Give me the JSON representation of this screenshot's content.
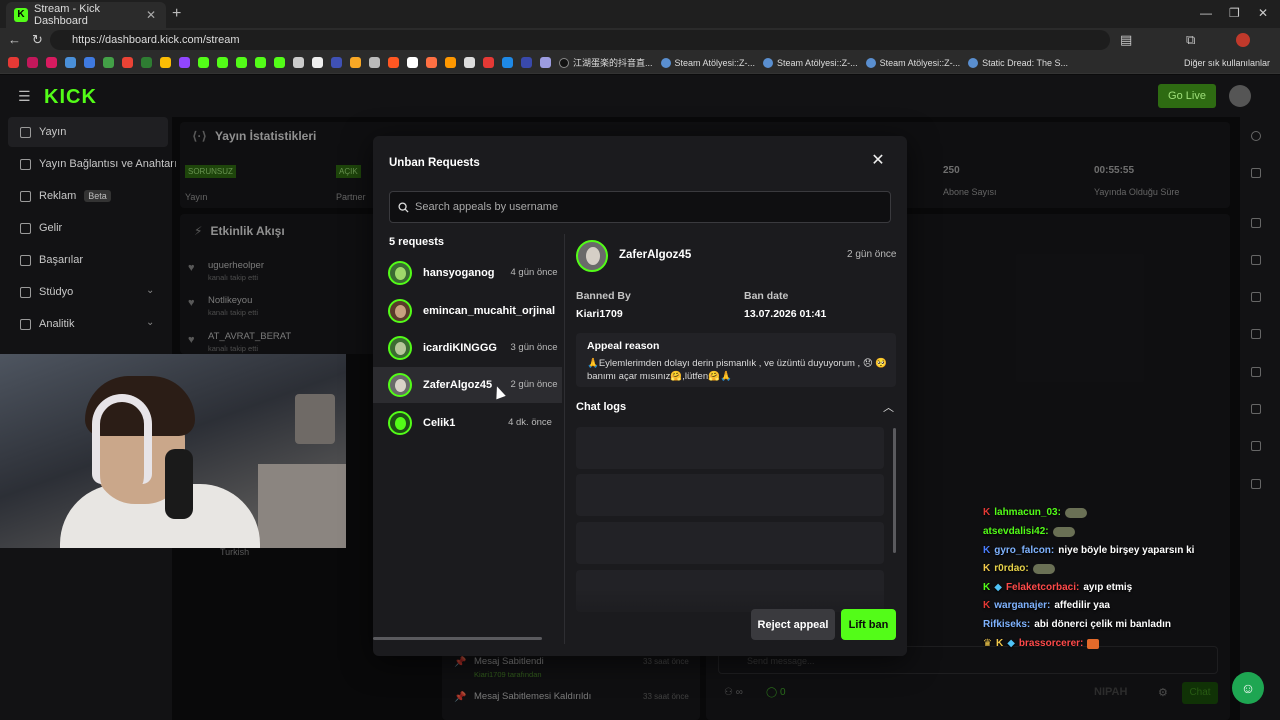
{
  "browser": {
    "tab_title": "Stream - Kick Dashboard",
    "url": "https://dashboard.kick.com/stream",
    "bookmarks": [
      "江湖蛋楽的抖音直...",
      "Steam Atölyesi::Z-...",
      "Steam Atölyesi::Z-...",
      "Steam Atölyesi::Z-...",
      "Static Dread: The S..."
    ],
    "other_bookmarks": "Diğer sık kullanılanlar"
  },
  "dashboard": {
    "logo": "KICK",
    "go_live": "Go Live",
    "sidebar": [
      {
        "label": "Yayın"
      },
      {
        "label": "Yayın Bağlantısı ve Anahtarı"
      },
      {
        "label": "Reklam",
        "badge": "Beta"
      },
      {
        "label": "Gelir"
      },
      {
        "label": "Başarılar"
      },
      {
        "label": "Stüdyo"
      },
      {
        "label": "Analitik"
      }
    ],
    "stats_title": "Yayın İstatistikleri",
    "stats": [
      {
        "badge": "SORUNSUZ",
        "label": "Yayın"
      },
      {
        "badge": "AÇIK",
        "label": "Partner"
      },
      {
        "value": "250",
        "label": "Abone Sayısı"
      },
      {
        "value": "00:55:55",
        "label": "Yayında Olduğu Süre"
      }
    ],
    "activity_title": "Etkinlik Akışı",
    "activity": [
      {
        "user": "uguerheolper",
        "sub": "kanalı takip etti"
      },
      {
        "user": "Notlikeyou",
        "sub": "kanalı takip etti"
      },
      {
        "user": "AT_AVRAT_BERAT",
        "sub": "kanalı takip etti"
      }
    ],
    "language": "Turkish",
    "pinned": [
      {
        "title": "Mesaj Sabitlendi",
        "by": "Kiari1709 tarafından",
        "when": "33 saat önce"
      },
      {
        "title": "Mesaj Sabitlemesi Kaldırıldı",
        "by": "",
        "when": "33 saat önce"
      }
    ],
    "send_placeholder": "Send message...",
    "viewer_count": "0",
    "chat_button": "Chat"
  },
  "chat_overlay": [
    {
      "user": "lahmacun_03:",
      "msg": "",
      "color": "#53fc18"
    },
    {
      "user": "atsevdalisi42:",
      "msg": "",
      "color": "#53fc18"
    },
    {
      "user": "gyro_falcon:",
      "msg": "niye böyle birşey yaparsın ki",
      "color": "#7fb3ff"
    },
    {
      "user": "r0rdao:",
      "msg": "",
      "color": "#e7d24a"
    },
    {
      "user": "Felaketcorbaci:",
      "msg": "ayıp etmiş",
      "color": "#ff4a4a"
    },
    {
      "user": "warganajer:",
      "msg": "affedilir yaa",
      "color": "#7fb3ff"
    },
    {
      "user": "Rifkiseks:",
      "msg": "abi dönerci çelik mi banladın",
      "color": "#7fb3ff"
    },
    {
      "user": "brassorcerer:",
      "msg": "",
      "color": "#ff4a4a"
    }
  ],
  "modal": {
    "title": "Unban Requests",
    "search_placeholder": "Search appeals by username",
    "count_label": "5 requests",
    "requests": [
      {
        "username": "hansyoganog",
        "when": "4 gün önce"
      },
      {
        "username": "emincan_mucahit_orjinal",
        "when": ""
      },
      {
        "username": "icardiKINGGG",
        "when": "3 gün önce"
      },
      {
        "username": "ZaferAlgoz45",
        "when": "2 gün önce"
      },
      {
        "username": "Celik1",
        "when": "4 dk. önce"
      }
    ],
    "detail": {
      "username": "ZaferAlgoz45",
      "when": "2 gün önce",
      "banned_by_label": "Banned By",
      "banned_by": "Kiari1709",
      "ban_date_label": "Ban date",
      "ban_date": "13.07.2026 01:41",
      "appeal_reason_label": "Appeal reason",
      "appeal_reason": "🙏Eylemlerimden dolayı derin pismanlık , ve üzüntü duyuyorum , 😞 🥺 banımı açar mısınız🤗,lütfen🤗🙏",
      "chat_logs_label": "Chat logs"
    },
    "reject_label": "Reject appeal",
    "lift_label": "Lift ban"
  }
}
